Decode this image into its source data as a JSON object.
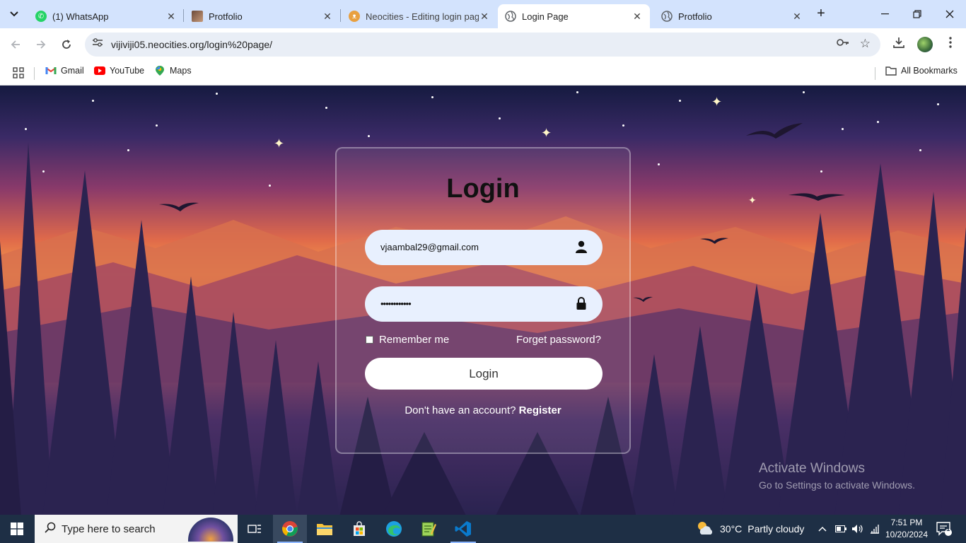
{
  "browser": {
    "tabs": [
      {
        "title": "(1) WhatsApp",
        "icon": "whatsapp-icon",
        "active": false
      },
      {
        "title": "Protfolio",
        "icon": "portfolio-thumb-icon",
        "active": false
      },
      {
        "title": "Neocities - Editing login pag",
        "icon": "neocities-cat-icon",
        "active": false
      },
      {
        "title": "Login Page",
        "icon": "globe-icon",
        "active": true
      },
      {
        "title": "Protfolio",
        "icon": "globe-icon",
        "active": false
      }
    ],
    "address": "vijiviji05.neocities.org/login%20page/",
    "bookmarks": [
      {
        "label": "Gmail",
        "icon": "gmail-icon"
      },
      {
        "label": "YouTube",
        "icon": "youtube-icon"
      },
      {
        "label": "Maps",
        "icon": "maps-icon"
      }
    ],
    "all_bookmarks": "All Bookmarks"
  },
  "login": {
    "title": "Login",
    "email_value": "vjaambal29@gmail.com",
    "password_mask": "••••••••••••",
    "remember_label": "Remember me",
    "forget_label": "Forget password?",
    "button_label": "Login",
    "no_account_text": "Don't have an account?",
    "register_label": "Register"
  },
  "watermark": {
    "line1": "Activate Windows",
    "line2": "Go to Settings to activate Windows."
  },
  "taskbar": {
    "search_placeholder": "Type here to search",
    "weather_temp": "30°C",
    "weather_desc": "Partly cloudy",
    "time": "7:51 PM",
    "date": "10/20/2024",
    "notification_count": "1"
  },
  "colors": {
    "tab_strip": "#d3e3fd",
    "taskbar": "#1e2f45",
    "input_bg": "#e8f0fe"
  }
}
